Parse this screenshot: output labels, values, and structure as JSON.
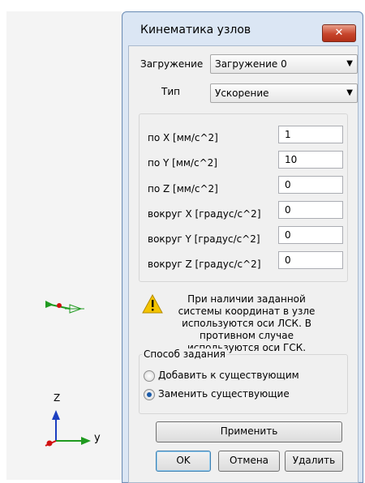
{
  "dialog": {
    "title": "Кинематика узлов",
    "close_label": "✕"
  },
  "load": {
    "label": "Загружение",
    "selected": "Загружение 0"
  },
  "type": {
    "label": "Тип",
    "selected": "Ускорение"
  },
  "fields": [
    {
      "label": "по X [мм/с^2]",
      "value": "1"
    },
    {
      "label": "по Y [мм/с^2]",
      "value": "10"
    },
    {
      "label": "по Z [мм/с^2]",
      "value": "0"
    },
    {
      "label": "вокруг X [градус/с^2]",
      "value": "0"
    },
    {
      "label": "вокруг Y [градус/с^2]",
      "value": "0"
    },
    {
      "label": "вокруг Z [градус/с^2]",
      "value": "0"
    }
  ],
  "warning": {
    "icon": "warning-icon",
    "text": "При наличии заданной системы координат в узле используются оси ЛСК. В противном случае используются оси ГСК."
  },
  "method": {
    "title": "Способ задания",
    "options": [
      {
        "label": "Добавить к существующим",
        "checked": false
      },
      {
        "label": "Заменить существующие",
        "checked": true
      }
    ]
  },
  "buttons": {
    "apply": "Применить",
    "ok": "OK",
    "cancel": "Отмена",
    "delete": "Удалить"
  },
  "viewport": {
    "axis_z": "Z",
    "axis_y": "y"
  },
  "colors": {
    "axis_green": "#1f9a1f",
    "axis_blue": "#1c3fc0",
    "origin_red": "#d11010"
  }
}
